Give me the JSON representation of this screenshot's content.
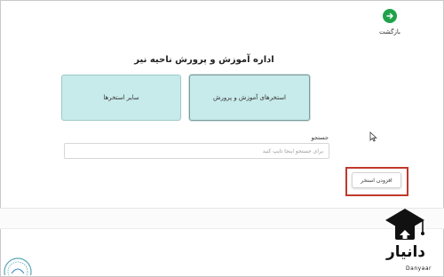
{
  "header": {
    "back_label": "بازگشت",
    "page_title": "اداره آموزش و پرورش ناحیه نیر"
  },
  "cards": {
    "education_pools": "استخرهای آموزش و پرورش",
    "other_pools": "سایر استخرها"
  },
  "search": {
    "label": "جستجو",
    "placeholder": "برای جستجو اینجا تایپ کنید",
    "value": ""
  },
  "actions": {
    "add_pool_label": "افزودن استخر"
  },
  "watermark": {
    "brand": "دانیار",
    "sub": "Danyaar"
  },
  "colors": {
    "back_button": "#1fa24a",
    "card_bg": "#c7eaea",
    "highlight": "#c0392b"
  }
}
